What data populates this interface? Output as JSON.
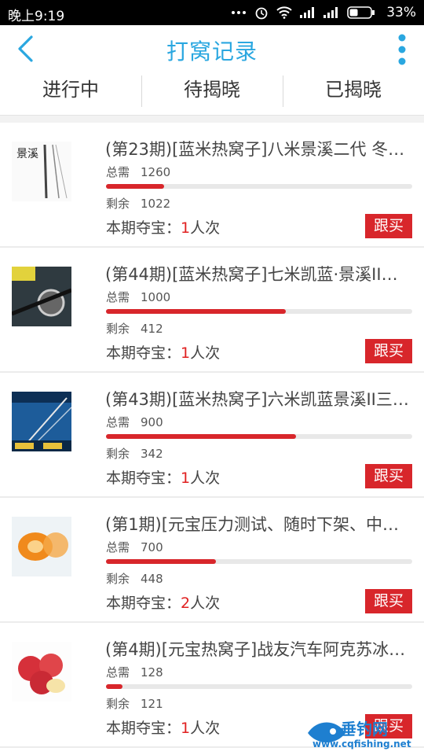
{
  "status_bar": {
    "time": "晚上9:19",
    "battery": "33%"
  },
  "header": {
    "title": "打窝记录"
  },
  "tabs": [
    "进行中",
    "待揭晓",
    "已揭晓"
  ],
  "labels": {
    "total": "总需",
    "remain": "剩余",
    "period_prefix": "本期夺宝：",
    "period_suffix": "人次",
    "follow": "跟买"
  },
  "items": [
    {
      "title": "(第23期)[蓝米热窝子]八米景溪二代 冬…",
      "total": "1260",
      "remain": "1022",
      "count": "1",
      "progress": 0.19,
      "thumb_text": "景溪"
    },
    {
      "title": "(第44期)[蓝米热窝子]七米凯蓝·景溪II三…",
      "total": "1000",
      "remain": "412",
      "count": "1",
      "progress": 0.588,
      "thumb_text": ""
    },
    {
      "title": "(第43期)[蓝米热窝子]六米凯蓝景溪II三…",
      "total": "900",
      "remain": "342",
      "count": "1",
      "progress": 0.62,
      "thumb_text": ""
    },
    {
      "title": "(第1期)[元宝压力测试、随时下架、中…",
      "total": "700",
      "remain": "448",
      "count": "2",
      "progress": 0.36,
      "thumb_text": ""
    },
    {
      "title": "(第4期)[元宝热窝子]战友汽车阿克苏冰…",
      "total": "128",
      "remain": "121",
      "count": "1",
      "progress": 0.055,
      "thumb_text": ""
    }
  ],
  "watermark": {
    "brand": "垂钓网",
    "url": "www.cqfishing.net"
  },
  "colors": {
    "accent": "#2aa7e0",
    "red": "#d8262b"
  }
}
